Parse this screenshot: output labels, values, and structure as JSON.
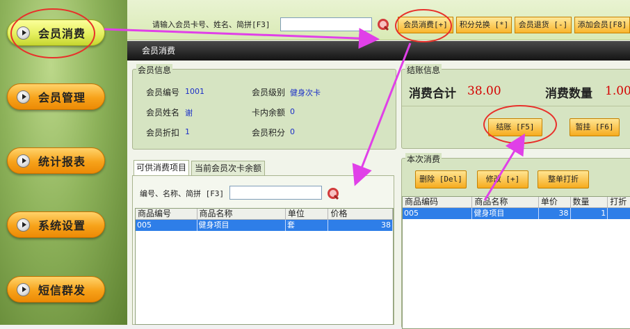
{
  "sidebar": {
    "items": [
      {
        "label": "会员消费"
      },
      {
        "label": "会员管理"
      },
      {
        "label": "统计报表"
      },
      {
        "label": "系统设置"
      },
      {
        "label": "短信群发"
      }
    ]
  },
  "topbar": {
    "search_label": "请输入会员卡号、姓名、简拼[F3]",
    "search_value": "",
    "buttons": [
      {
        "label": "会员消费[+]"
      },
      {
        "label": "积分兑换 [*]"
      },
      {
        "label": "会员退货 [-]"
      },
      {
        "label": "添加会员[F8]"
      }
    ]
  },
  "dialog": {
    "title": "会员消费",
    "member_info": {
      "group_title": "会员信息",
      "fields": [
        {
          "key": "会员编号",
          "value": "1001"
        },
        {
          "key": "会员级别",
          "value": "健身次卡"
        },
        {
          "key": "会员姓名",
          "value": "谢"
        },
        {
          "key": "卡内余额",
          "value": "0"
        },
        {
          "key": "会员折扣",
          "value": "1"
        },
        {
          "key": "会员积分",
          "value": "0"
        }
      ]
    },
    "checkout": {
      "group_title": "结账信息",
      "total_label": "消费合计",
      "total_value": "38.00",
      "qty_label": "消费数量",
      "qty_value": "1.00",
      "checkout_btn": "结账 [F5]",
      "hold_btn": "暂挂 [F6]"
    },
    "tabs": [
      {
        "label": "可供消费项目"
      },
      {
        "label": "当前会员次卡余额"
      }
    ],
    "item_search": {
      "label": "编号、名称、简拼 [F3]",
      "value": ""
    },
    "items_table": {
      "columns": [
        "商品编号",
        "商品名称",
        "单位",
        "价格"
      ],
      "rows": [
        [
          "005",
          "健身项目",
          "套",
          "38"
        ]
      ]
    },
    "current": {
      "group_title": "本次消费",
      "delete_btn": "删除 [Del]",
      "edit_btn": "修改 [+]",
      "discount_btn": "整单打折",
      "columns": [
        "商品编码",
        "商品名称",
        "单价",
        "数量",
        "打折"
      ],
      "rows": [
        [
          "005",
          "健身项目",
          "38",
          "1",
          ""
        ]
      ]
    }
  },
  "colors": {
    "annotation": "#e040e8",
    "highlight_ring": "#e8302a",
    "selected_row": "#2e7ee8",
    "price_red": "#d40000"
  }
}
